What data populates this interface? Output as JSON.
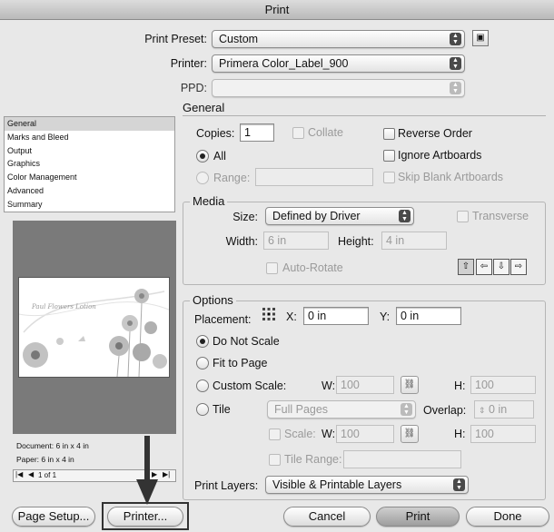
{
  "window": {
    "title": "Print"
  },
  "top": {
    "preset_label": "Print Preset:",
    "preset_value": "Custom",
    "printer_label": "Printer:",
    "printer_value": "Primera Color_Label_900",
    "ppd_label": "PPD:",
    "ppd_value": ""
  },
  "sidebar": {
    "items": [
      "General",
      "Marks and Bleed",
      "Output",
      "Graphics",
      "Color Management",
      "Advanced",
      "Summary"
    ],
    "selected": "General"
  },
  "preview": {
    "document": "Document: 6 in x 4 in",
    "paper": "Paper: 6 in x 4 in",
    "page": "1 of 1",
    "label_script": "Paul Flowers Lotion"
  },
  "general": {
    "title": "General",
    "copies_label": "Copies:",
    "copies_value": "1",
    "collate": "Collate",
    "reverse_order": "Reverse Order",
    "all": "All",
    "range": "Range:",
    "ignore_artboards": "Ignore Artboards",
    "skip_blank": "Skip Blank Artboards"
  },
  "media": {
    "title": "Media",
    "size_label": "Size:",
    "size_value": "Defined by Driver",
    "transverse": "Transverse",
    "width_label": "Width:",
    "width_value": "6 in",
    "height_label": "Height:",
    "height_value": "4 in",
    "auto_rotate": "Auto-Rotate"
  },
  "options": {
    "title": "Options",
    "placement_label": "Placement:",
    "x_label": "X:",
    "x_value": "0 in",
    "y_label": "Y:",
    "y_value": "0 in",
    "do_not_scale": "Do Not Scale",
    "fit_to_page": "Fit to Page",
    "custom_scale": "Custom Scale:",
    "w_label": "W:",
    "w_value": "100",
    "h_label": "H:",
    "h_value": "100",
    "tile": "Tile",
    "tile_value": "Full Pages",
    "overlap_label": "Overlap:",
    "overlap_value": "0 in",
    "scale": "Scale:",
    "scale_w_label": "W:",
    "scale_w_value": "100",
    "scale_h_label": "H:",
    "scale_h_value": "100",
    "tile_range": "Tile Range:",
    "print_layers_label": "Print Layers:",
    "print_layers_value": "Visible & Printable Layers"
  },
  "buttons": {
    "page_setup": "Page Setup...",
    "printer": "Printer...",
    "cancel": "Cancel",
    "print": "Print",
    "done": "Done"
  },
  "colors": {
    "annotation": "#333333",
    "preview_bg": "#7a7a7a",
    "flowers": "#b9b9b9"
  }
}
